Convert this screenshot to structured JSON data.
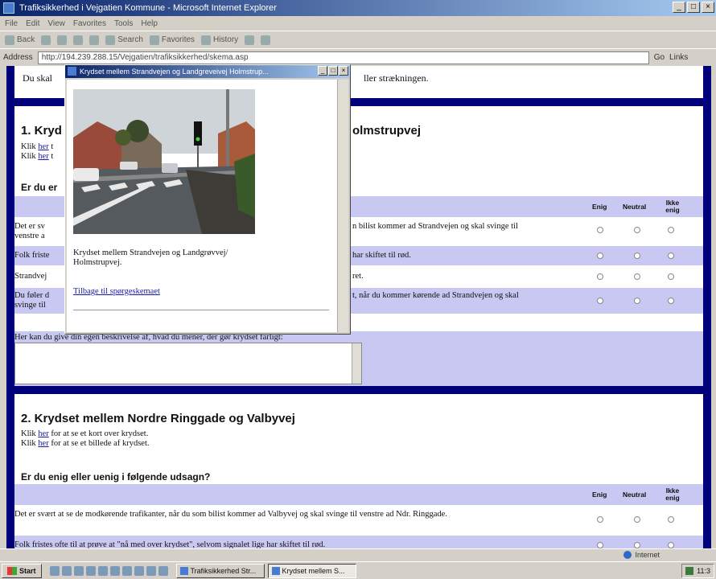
{
  "window": {
    "title": "Trafiksikkerhed i Vejgatien Kommune - Microsoft Internet Explorer",
    "controls": [
      "_",
      "□",
      "×"
    ]
  },
  "menubar": {
    "items": [
      "File",
      "Edit",
      "View",
      "Favorites",
      "Tools",
      "Help"
    ]
  },
  "toolbar": {
    "back": "Back",
    "search": "Search",
    "favorites": "Favorites",
    "history": "History"
  },
  "address": {
    "label": "Address",
    "url": "http://194.239.288.15/Vejgatien/trafiksikkerhed/skema.asp",
    "go": "Go",
    "links": "Links"
  },
  "page": {
    "top_text_start": "Du skal",
    "top_text_end": "ller strækningen.",
    "section1": {
      "title_start": "1. Kryd",
      "title_end": "olmstrupvej",
      "link1_pre": "Klik ",
      "link1_word": "her",
      "link1_post": " t",
      "link2_pre": "Klik ",
      "link2_word": "her",
      "link2_post": " t",
      "question_start": "Er du er",
      "headers": {
        "agree": "Enig",
        "neutral": "Neutral",
        "disagree": "Ikke enig"
      },
      "rows": [
        {
          "left": "Det er sv",
          "left2": "venstre a",
          "right": "n bilist kommer ad Strandvejen og skal svinge til"
        },
        {
          "left": "Folk friste",
          "right": "har skiftet til rød."
        },
        {
          "left": "Strandvej",
          "right": "ret."
        },
        {
          "left": "Du føler d",
          "left2": "svinge til",
          "right": "t, når du kommer kørende ad Strandvejen og skal"
        }
      ],
      "comment_label": "Her kan du give din egen beskrivelse af, hvad du mener, der gør krydset farligt:"
    },
    "section2": {
      "title": "2. Krydset mellem Nordre Ringgade og Valbyvej",
      "link1_pre": "Klik ",
      "link1_word": "her",
      "link1_post": " for at se et kort over krydset.",
      "link2_pre": "Klik ",
      "link2_word": "her",
      "link2_post": " for at se et billede af krydset.",
      "question": "Er du enig eller uenig i følgende udsagn?",
      "headers": {
        "agree": "Enig",
        "neutral": "Neutral",
        "disagree": "Ikke enig"
      },
      "rows": [
        {
          "text": "Det er svært at se de modkørende trafikanter, når du som bilist kommer ad Valbyvej og skal svinge til venstre ad Ndr. Ringgade."
        },
        {
          "text": "Folk fristes ofte til at prøve at \"nå med over krydset\", selvom signalet lige har skiftet til rød."
        }
      ]
    }
  },
  "popup": {
    "title": "Krydset mellem Strandvejen og Landgreveivej Holmstrup...",
    "caption": "Krydset mellem Strandvejen og Landgrøvvej/ Holmstrupvej.",
    "back_link": "Tilbage til spørgeskemaet"
  },
  "statusbar": {
    "zone": "Internet"
  },
  "taskbar": {
    "start": "Start",
    "tasks": [
      "Trafiksikkerhed Str...",
      "Krydset mellem S..."
    ],
    "clock": "11:3"
  }
}
